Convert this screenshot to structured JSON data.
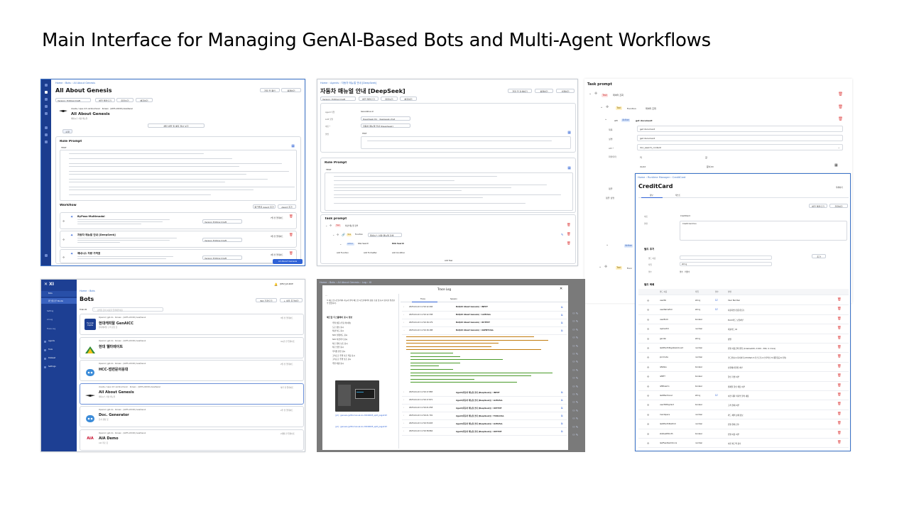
{
  "slide_title": "Main Interface for Managing GenAI-Based Bots and Multi-Agent Workflows",
  "s1": {
    "breadcrumb": "Home › Bots › All About Genesis",
    "title": "All About Genesis",
    "header_btn1": "저장 전 확인",
    "header_btn2": "복제하기",
    "version_select": "Version: Editing Draft",
    "tabs": [
      "버전 불러오기",
      "미리보기",
      "배포하기"
    ],
    "bot_name": "All About Genesis",
    "bot_desc": "제네시스 차량 매뉴얼",
    "bot_meta": "claude / opus 4.5 cardinal tenor · Korean · (GMT+09:00) Asia/Seoul",
    "center_btn": "해당 버전 및 배포 정보 보기",
    "small_btn": "수정",
    "role_prompt_label": "Role Prompt",
    "role_text_label": "TEXT",
    "workflow_label": "Workflow",
    "wf_btn1": "워크플로 Agent 추가",
    "wf_btn2": "Agent 추가",
    "agents": [
      {
        "name": "ByPass-Multimodal",
        "version": "Version Editing Draft",
        "date": "7일 전 업데이트"
      },
      {
        "name": "자동차 매뉴얼 안내 [DeepSeek]",
        "version": "Version Editing Draft",
        "date": "3일 전 업데이트"
      },
      {
        "name": "제네시스 차량 가격표",
        "version": "Version Editing Draft",
        "date": "4일 전 업데이트"
      }
    ],
    "bottom_btn": "All About Genesis"
  },
  "s2": {
    "breadcrumb": "Home › Agents › 자동차 매뉴얼 안내 [DeepSeek]",
    "title": "자동차 매뉴얼 안내 [DeepSeek]",
    "header_btns": [
      "저장 전 검색하기",
      "복제하기",
      "삭제하기"
    ],
    "version_select": "Version: Editing Draft",
    "tabs": [
      "버전 불러오기",
      "미리보기",
      "배포하기"
    ],
    "fields": [
      {
        "label": "Agent 타입",
        "value": "Generative AI"
      },
      {
        "label": "LLM 모델",
        "value": "DeepSeek R1 · deepseek-chat"
      },
      {
        "label": "이름 *",
        "value": "자동차 매뉴얼 안내 [DeepSeek]"
      },
      {
        "label": "설명",
        "value": "TEXT"
      }
    ],
    "role_prompt_label": "Role Prompt",
    "role_text_label": "TEXT",
    "task_prompt_label": "Task prompt",
    "task_tag": "Task",
    "task_name": "차량 매뉴얼 검색",
    "tool_tag": "Tool",
    "tool_fn": "Function",
    "tool_name": "제네시스 차량 매뉴얼 검색",
    "action_tag": "Action",
    "action_name": "RAG Search",
    "action_value": "RAG Search",
    "add_links": [
      "Add Function",
      "Add Formatter",
      "Add Condition"
    ],
    "add_task": "Add Task"
  },
  "s3": {
    "task_prompt_label": "Task prompt",
    "task_tag": "Task",
    "task_name": "데이터 조회",
    "tool_tag": "Tool",
    "tool_fn": "Function",
    "tool_name": "데이터 조회",
    "action_api": "API",
    "action_tag": "Action",
    "action_name": "get document",
    "fields": [
      {
        "label": "제목",
        "value": "get document"
      },
      {
        "label": "설명",
        "value": "get document"
      },
      {
        "label": "API *",
        "value": "doc_search_content"
      },
      {
        "label": "파라미터",
        "value": ""
      }
    ],
    "param_cols": [
      "키",
      "값"
    ],
    "param_row": [
      "docId",
      "문서 ID"
    ],
    "side_labels": [
      "템플",
      "템플 설명"
    ],
    "action_tag2": "Action",
    "tool_tag2": "Tool",
    "tool_fn2": "Func"
  },
  "s4": {
    "app_name": "XI",
    "nav": [
      "Bots",
      "워크플로우 Studio",
      "Setting",
      "AI Log",
      "Trace Log",
      "Agents",
      "Tools",
      "Dataset",
      "Settings"
    ],
    "breadcrumb": "Home › Bots",
    "title": "Bots",
    "total": "Total 26",
    "search_placeholder": "검색할 봇의 이름을 입력해주세요",
    "btn_template": "Bot 가져오기",
    "btn_new": "+ 새로 추가하기",
    "user": "[DEV] JAY-RICE",
    "bots": [
      {
        "name": "현대캐피탈 GenAICC",
        "desc": "현대캐피탈 고객 상담 봇",
        "meta": "OpenAI / gpt-4o · Korean · (GMT+09:00) Asia/Seoul",
        "date": "3일 전 업데이트",
        "logo": "Hyundai Capital"
      },
      {
        "name": "현대 웰타메이트",
        "desc": "",
        "meta": "OpenAI / gpt-4o · Korean · (GMT+09:00) Asia/Seoul",
        "date": "4시간 전 업데이트",
        "logo": ""
      },
      {
        "name": "HCC-범련문의응대",
        "desc": "",
        "meta": "OpenAI / gpt-4o · Korean · (GMT+09:00) Asia/Seoul",
        "date": "2일 전 업데이트",
        "logo": ""
      },
      {
        "name": "All About Genesis",
        "desc": "제네시스 차량 매뉴얼",
        "meta": "claude / opus 4.5 cardinal tenor · Korean · (GMT+09:00) Asia/Seoul",
        "date": "하루 전 업데이트",
        "logo": ""
      },
      {
        "name": "Doc. Generator",
        "desc": "문서 생성 봇",
        "meta": "OpenAI / gpt-4o · Korean · (GMT+09:00) Asia/Seoul",
        "date": "2주 전 업데이트",
        "logo": ""
      },
      {
        "name": "AIA Demo",
        "desc": "AIA 데모 봇",
        "meta": "OpenAI / gpt-4o · Korean · (GMT+09:00) Asia/Seoul",
        "date": "2개월 전 업데이트",
        "logo": "AIA"
      }
    ]
  },
  "s5": {
    "breadcrumb": "Home › Bots › All About Genesis › Log › XI",
    "modal_title": "Trace Log",
    "tabs": [
      "Trace",
      "Session"
    ],
    "chat_heading": "3. 헤드업 디스플레이 기능과 위쪽 헤드업 디스플레이의 형상 조정 및 표시 항목을 변경할 수 있습니다.",
    "chat_section": "헤드업 디스플레이 표시 정보",
    "chat_items": [
      "주행 설문 (주요 마이카)",
      "도로 정보 표시",
      "차량 속도 표시",
      "SCC 설정속도 표시",
      "SCC 차간거리 표시",
      "차로 유지 보조 표시",
      "차로 안전 표시",
      "후측방 안전 표시",
      "고속도로 주행 보조 작동 표시",
      "고속도로 주행 보조 표시",
      "주변 차량 표시"
    ],
    "chat_links": [
      "출처 : genesis-gv80-manual-ko-20240605_split_page193",
      "출처 : genesis-gv80-manual-ko-20240605_split_page193"
    ],
    "traces": [
      {
        "time": "2025-04-10 11:50:12.294",
        "name": "Bot(All About Genesis) : INPUT"
      },
      {
        "time": "2025-04-10 11:50:12.338",
        "name": "Bot(All About Genesis) : LLMCALL"
      },
      {
        "time": "2025-04-10 11:50:18.179",
        "name": "Bot(All About Genesis) : OUTPUT"
      },
      {
        "time": "2025-04-10 11:50:18.188",
        "name": "Bot(All About Genesis) : AGENTCALL"
      },
      {
        "time": "2025-04-10 11:50:17.883",
        "name": "Agent(자동차 매뉴얼 안내 [DeepSeek]) : INPUT"
      },
      {
        "time": "2025-04-10 11:50:17.871",
        "name": "Agent(자동차 매뉴얼 안내 [DeepSeek]) : LLMCALL"
      },
      {
        "time": "2025-04-10 11:50:21.058",
        "name": "Agent(자동차 매뉴얼 안내 [DeepSeek]) : OUTPUT"
      },
      {
        "time": "2025-04-10 11:50:21.701",
        "name": "Agent(자동차 매뉴얼 안내 [DeepSeek]) : TOOLCALL"
      },
      {
        "time": "2025-04-10 11:50:33.603",
        "name": "Agent(자동차 매뉴얼 안내 [DeepSeek]) : LLMCALL"
      },
      {
        "time": "2025-04-10 11:50:38.862",
        "name": "Agent(자동차 매뉴얼 안내 [DeepSeek]) : OUTPUT"
      }
    ]
  },
  "s6": {
    "breadcrumb": "Home › Runtime Manager › CreditCard",
    "title": "CreditCard",
    "header_btn": "복제하기",
    "tabs": [
      "정보",
      "테스트"
    ],
    "btns": [
      "버전 불러오기",
      "저장하기"
    ],
    "fields": [
      {
        "label": "이름",
        "value": "CreditCard"
      },
      {
        "label": "설명",
        "value": "Credit Card tool"
      }
    ],
    "field_add_label": "필드 추가",
    "field_add_rows": [
      {
        "label": "필드 이름",
        "value": ""
      },
      {
        "label": "타입",
        "value": "string"
      },
      {
        "label": "필수",
        "value": "필수 · 비필수"
      }
    ],
    "add_btn": "추가",
    "field_list_label": "필드 목록",
    "cols": [
      "필드 이름",
      "타입",
      "필수",
      "설명"
    ],
    "rows": [
      {
        "name": "userNo",
        "type": "string",
        "req": true,
        "desc": "User Number"
      },
      {
        "name": "userNameFull",
        "type": "string",
        "req": true,
        "desc": "사용자명 (영문/한글)"
      },
      {
        "name": "userPLCC",
        "type": "boolean",
        "req": false,
        "desc": "PLCC카드 보유여부"
      },
      {
        "name": "repCardId",
        "type": "number",
        "req": false,
        "desc": "대표카드 ID"
      },
      {
        "name": "gender",
        "type": "string",
        "req": false,
        "desc": "성별"
      },
      {
        "name": "lastMonthPayableAmount",
        "type": "number",
        "req": false,
        "desc": "전월 사용금액 범위 (1:below100, 2:100 - 300, 4: more)"
      },
      {
        "name": "plccCode",
        "type": "number",
        "req": false,
        "desc": "코드번호(1:다이어리,2:E-Mart,3:코스트코,4:스타벅스,5:대한항공,6:기타)"
      },
      {
        "name": "isNiAbe",
        "type": "boolean",
        "req": false,
        "desc": "선결제/리볼빙 여부"
      },
      {
        "name": "isMHT",
        "type": "boolean",
        "req": false,
        "desc": "할인 가맹 여부"
      },
      {
        "name": "isMDaemo",
        "type": "boolean",
        "req": false,
        "desc": "결제일 할인 해당 여부"
      },
      {
        "name": "lastMentioned",
        "type": "string",
        "req": true,
        "desc": "이전 대화 마지막 질의 내용"
      },
      {
        "name": "userTotPayCard",
        "type": "boolean",
        "req": false,
        "desc": "고객 결제 여부"
      },
      {
        "name": "mainSpecs",
        "type": "number",
        "req": false,
        "desc": "카드 혜택 상세 정보"
      },
      {
        "name": "lastMonthPaidCnt",
        "type": "number",
        "req": false,
        "desc": "전월 결제 건수"
      },
      {
        "name": "statLastMonth",
        "type": "boolean",
        "req": false,
        "desc": "전월 이용 여부"
      },
      {
        "name": "lastFeedbackScore",
        "type": "number",
        "req": false,
        "desc": "이전 피드백 점수"
      }
    ]
  }
}
